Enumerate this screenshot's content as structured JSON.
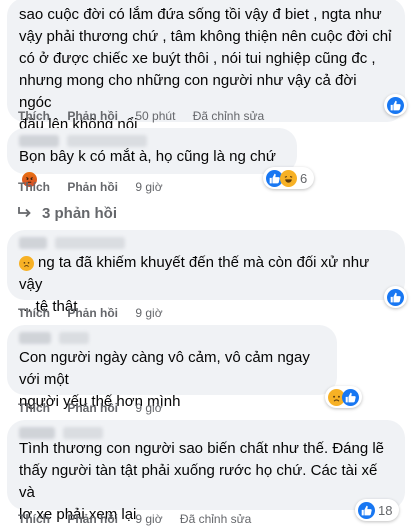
{
  "comments": [
    {
      "lines": [
        "sao cuộc đời có lắm đứa sống tồi vậy đ biet , ngta như",
        "vậy phải thương chứ , tâm không thiện nên cuộc đời chỉ",
        "có ở được chiếc xe buýt thôi , nói tui nghiệp cũng đc ,",
        "nhưng mong cho những con người như vậy cả đời ngóc",
        "đầu lên không nổi"
      ],
      "like_label": "Thích",
      "reply_label": "Phản hồi",
      "time": "50 phút",
      "edited": "Đã chỉnh sửa",
      "reactions": [
        "like"
      ],
      "reaction_count": ""
    },
    {
      "lines": [
        "Bọn bây k có mắt à, họ cũng là ng chứ"
      ],
      "like_label": "Thích",
      "reply_label": "Phản hồi",
      "time": "9 giờ",
      "edited": "",
      "reactions": [
        "like",
        "haha"
      ],
      "reaction_count": "6",
      "replies_label": "3 phản hồi"
    },
    {
      "lines": [
        "ng ta đã khiếm khuyết đến thế mà còn đối xử như vậy",
        "... tệ thật"
      ],
      "like_label": "Thích",
      "reply_label": "Phản hồi",
      "time": "9 giờ",
      "edited": "",
      "reactions": [
        "like"
      ],
      "reaction_count": ""
    },
    {
      "lines": [
        "Con người ngày càng vô cảm, vô cảm ngay với một",
        "người yếu thế hơn mình"
      ],
      "like_label": "Thích",
      "reply_label": "Phản hồi",
      "time": "9 giờ",
      "edited": "",
      "reactions": [
        "sad",
        "like"
      ],
      "reaction_count": ""
    },
    {
      "lines": [
        "Tình thương con người sao biến chất như thế. Đáng lẽ",
        "thấy người tàn tật phải xuống rước họ chứ. Các tài xế và",
        "lơ xe phải xem lại"
      ],
      "like_label": "Thích",
      "reply_label": "Phản hồi",
      "time": "9 giờ",
      "edited": "Đã chỉnh sửa",
      "reactions": [
        "like"
      ],
      "reaction_count": "18"
    }
  ],
  "icons": {
    "like": "thumbs-up-icon",
    "haha": "laughing-emoji-icon",
    "sad": "sad-emoji-icon",
    "angry": "angry-emoji-icon",
    "replies": "reply-arrow-icon"
  },
  "colors": {
    "bubble": "#f0f2f5",
    "meta_text": "#65676b",
    "like_blue": "#1877f2",
    "emoji_yellow": "#f7b125"
  }
}
